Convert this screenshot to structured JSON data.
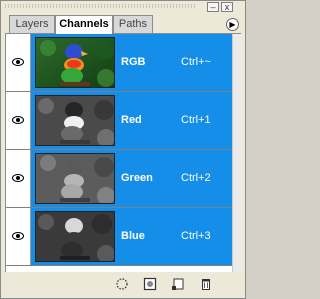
{
  "window": {
    "minimize_label": "–",
    "close_label": "x"
  },
  "tabs": [
    {
      "label": "Layers",
      "active": false
    },
    {
      "label": "Channels",
      "active": true
    },
    {
      "label": "Paths",
      "active": false
    }
  ],
  "panel_menu_icon": "panel-menu-arrow-icon",
  "channels": [
    {
      "name": "RGB",
      "shortcut": "Ctrl+~",
      "visible": true,
      "selected": true,
      "thumbnail": "color"
    },
    {
      "name": "Red",
      "shortcut": "Ctrl+1",
      "visible": true,
      "selected": true,
      "thumbnail": "grayscale"
    },
    {
      "name": "Green",
      "shortcut": "Ctrl+2",
      "visible": true,
      "selected": true,
      "thumbnail": "grayscale"
    },
    {
      "name": "Blue",
      "shortcut": "Ctrl+3",
      "visible": true,
      "selected": true,
      "thumbnail": "grayscale"
    }
  ],
  "bottom_tools": [
    {
      "name": "load-channel-as-selection-icon"
    },
    {
      "name": "save-selection-as-channel-icon"
    },
    {
      "name": "new-channel-icon"
    },
    {
      "name": "delete-channel-icon"
    }
  ],
  "colors": {
    "selection": "#148ee9",
    "panel_bg": "#ece9d8"
  }
}
